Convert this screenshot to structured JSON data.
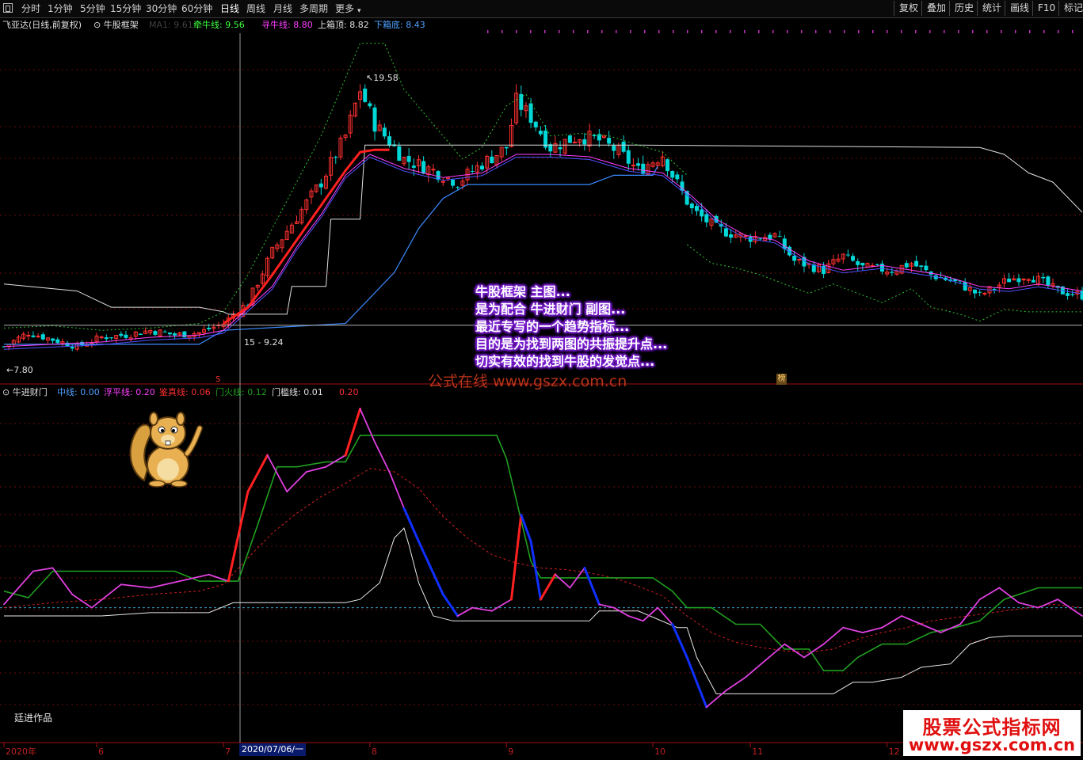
{
  "toolbar": {
    "periods": [
      "分时",
      "1分钟",
      "5分钟",
      "15分钟",
      "30分钟",
      "60分钟",
      "日线",
      "周线",
      "月线",
      "多周期",
      "更多"
    ],
    "active_period": "日线",
    "right_buttons": [
      "复权",
      "叠加",
      "历史",
      "统计",
      "画线",
      "F10",
      "标记"
    ]
  },
  "main_legend": {
    "stock": "飞亚达(日线,前复权)",
    "indicator": "牛股框架",
    "ma_text": "MA1: 9.61",
    "qianniu": "牵牛线: 9.56",
    "xunniu": "寻牛线: 8.80",
    "shangxiang": "上箱顶: 8.82",
    "xiaxiang": "下箱底: 8.43"
  },
  "sub_legend": {
    "indicator": "牛进财门",
    "zhongxian": "中线: 0.00",
    "fupingxian": "浮平线: 0.20",
    "jianzhenxian": "鉴真线: 0.06",
    "menhuoxian": "门火线: 0.12",
    "menkanxian": "门槛线: 0.01",
    "extra": "0.20"
  },
  "annotation": [
    "牛股框架 主图...",
    "是为配合 牛进财门 副图...",
    "最近专写的一个趋势指标...",
    "目的是为找到两图的共振提升点...",
    "切实有效的找到牛股的发觉点..."
  ],
  "watermark_text": "公式在线 www.gszx.com.cn",
  "watermark_box": {
    "line1": "股票公式指标网",
    "line2": "www.gszx.com.cn"
  },
  "credit": "廷进作品",
  "tags": {
    "bang": "榜",
    "s": "S",
    "current_date": "2020/07/06/一"
  },
  "price_labels": {
    "high": "19.58",
    "low": "7.80",
    "mid": "15 - 9.24"
  },
  "axis_labels": [
    {
      "t": 0,
      "label": "2020年"
    },
    {
      "t": 19,
      "label": "6"
    },
    {
      "t": 45,
      "label": "7"
    },
    {
      "t": 75,
      "label": "8"
    },
    {
      "t": 103,
      "label": "9"
    },
    {
      "t": 133,
      "label": "10"
    },
    {
      "t": 153,
      "label": "11"
    },
    {
      "t": 181,
      "label": "12"
    }
  ],
  "colors": {
    "up": "#ff3030",
    "down": "#00d8d8",
    "qianniu": "#ff2020",
    "xunniu": "#ff40ff",
    "box_top": "#e0e0e0",
    "box_bottom": "#3c8cff",
    "band": "#30c030",
    "ma": "#5050ff"
  },
  "chart_data": [
    {
      "type": "candlestick",
      "title": "牛股框架",
      "x_range": [
        0,
        221
      ],
      "ylim": [
        6.8,
        21.5
      ],
      "close_anchors": [
        [
          0,
          7.9
        ],
        [
          5,
          8.5
        ],
        [
          10,
          8.2
        ],
        [
          15,
          7.9
        ],
        [
          20,
          8.3
        ],
        [
          25,
          8.4
        ],
        [
          30,
          8.6
        ],
        [
          35,
          8.4
        ],
        [
          40,
          8.5
        ],
        [
          45,
          8.9
        ],
        [
          50,
          9.8
        ],
        [
          55,
          12.0
        ],
        [
          60,
          13.5
        ],
        [
          65,
          15.0
        ],
        [
          70,
          17.0
        ],
        [
          73,
          19.0
        ],
        [
          76,
          17.5
        ],
        [
          82,
          16.0
        ],
        [
          88,
          15.5
        ],
        [
          93,
          15.0
        ],
        [
          98,
          15.8
        ],
        [
          103,
          16.5
        ],
        [
          105,
          18.5
        ],
        [
          108,
          17.8
        ],
        [
          112,
          16.5
        ],
        [
          118,
          17.0
        ],
        [
          122,
          16.8
        ],
        [
          126,
          16.3
        ],
        [
          130,
          15.5
        ],
        [
          135,
          16.2
        ],
        [
          137,
          15.3
        ],
        [
          141,
          13.8
        ],
        [
          146,
          13.0
        ],
        [
          152,
          12.6
        ],
        [
          158,
          12.7
        ],
        [
          162,
          11.6
        ],
        [
          168,
          11.2
        ],
        [
          172,
          11.8
        ],
        [
          176,
          11.3
        ],
        [
          182,
          11.2
        ],
        [
          186,
          11.5
        ],
        [
          190,
          11.0
        ],
        [
          196,
          10.6
        ],
        [
          200,
          10.1
        ],
        [
          206,
          10.8
        ],
        [
          210,
          11.0
        ],
        [
          216,
          10.3
        ],
        [
          221,
          10.1
        ]
      ],
      "qianniu": [
        [
          45,
          8.9
        ],
        [
          50,
          9.6
        ],
        [
          55,
          11.0
        ],
        [
          60,
          12.5
        ],
        [
          65,
          14.0
        ],
        [
          70,
          15.5
        ],
        [
          73,
          16.3
        ],
        [
          76,
          16.4
        ],
        [
          79,
          16.4
        ]
      ],
      "xunniu": [
        [
          0,
          7.9
        ],
        [
          10,
          8.0
        ],
        [
          20,
          8.1
        ],
        [
          30,
          8.3
        ],
        [
          40,
          8.4
        ],
        [
          45,
          8.6
        ],
        [
          55,
          10.5
        ],
        [
          60,
          12.2
        ],
        [
          65,
          13.6
        ],
        [
          70,
          15.3
        ],
        [
          75,
          16.2
        ],
        [
          82,
          15.6
        ],
        [
          90,
          15.2
        ],
        [
          98,
          15.4
        ],
        [
          105,
          16.2
        ],
        [
          112,
          16.2
        ],
        [
          120,
          16.1
        ],
        [
          128,
          15.6
        ],
        [
          135,
          15.4
        ],
        [
          141,
          14.4
        ],
        [
          146,
          13.4
        ],
        [
          152,
          12.7
        ],
        [
          158,
          12.5
        ],
        [
          165,
          11.6
        ],
        [
          172,
          11.2
        ],
        [
          180,
          11.4
        ],
        [
          186,
          11.2
        ],
        [
          192,
          11.0
        ],
        [
          200,
          10.5
        ],
        [
          206,
          10.4
        ],
        [
          212,
          10.6
        ],
        [
          221,
          10.3
        ]
      ],
      "box_top": [
        [
          0,
          10.6
        ],
        [
          15,
          10.3
        ],
        [
          22,
          9.6
        ],
        [
          40,
          9.6
        ],
        [
          45,
          9.4
        ],
        [
          46,
          9.3
        ],
        [
          58,
          9.3
        ],
        [
          59,
          10.5
        ],
        [
          66,
          10.5
        ],
        [
          67,
          13.4
        ],
        [
          73,
          13.4
        ],
        [
          74,
          16.6
        ],
        [
          130,
          16.6
        ],
        [
          200,
          16.5
        ],
        [
          205,
          16.2
        ],
        [
          210,
          15.4
        ],
        [
          215,
          15.0
        ],
        [
          221,
          13.7
        ]
      ],
      "box_bottom": [
        [
          0,
          8.0
        ],
        [
          40,
          8.0
        ],
        [
          45,
          8.6
        ],
        [
          70,
          8.9
        ],
        [
          80,
          11.1
        ],
        [
          85,
          13.0
        ],
        [
          90,
          14.3
        ],
        [
          95,
          14.9
        ],
        [
          100,
          14.9
        ],
        [
          120,
          14.9
        ],
        [
          125,
          15.3
        ],
        [
          133,
          15.3
        ],
        [
          134,
          15.7
        ]
      ],
      "band_upper": [
        [
          0,
          8.7
        ],
        [
          10,
          8.8
        ],
        [
          20,
          8.6
        ],
        [
          30,
          8.7
        ],
        [
          40,
          8.9
        ],
        [
          45,
          9.4
        ],
        [
          50,
          11.0
        ],
        [
          55,
          13.0
        ],
        [
          60,
          15.0
        ],
        [
          65,
          17.0
        ],
        [
          70,
          19.5
        ],
        [
          73,
          21.0
        ],
        [
          78,
          21.0
        ],
        [
          82,
          19.0
        ],
        [
          88,
          17.5
        ],
        [
          94,
          16.0
        ],
        [
          98,
          16.5
        ],
        [
          103,
          18.3
        ],
        [
          107,
          18.8
        ],
        [
          112,
          17.0
        ],
        [
          118,
          17.1
        ],
        [
          124,
          17.0
        ],
        [
          130,
          16.6
        ],
        [
          135,
          16.3
        ],
        [
          140,
          15.3
        ]
      ],
      "band_lower": [
        [
          140,
          12.3
        ],
        [
          145,
          11.5
        ],
        [
          150,
          11.3
        ],
        [
          155,
          11.0
        ],
        [
          160,
          10.6
        ],
        [
          165,
          10.2
        ],
        [
          170,
          10.6
        ],
        [
          175,
          10.2
        ],
        [
          180,
          9.8
        ],
        [
          186,
          10.4
        ],
        [
          190,
          9.6
        ],
        [
          196,
          9.3
        ],
        [
          200,
          9.0
        ],
        [
          205,
          9.5
        ],
        [
          210,
          9.4
        ],
        [
          216,
          9.4
        ],
        [
          221,
          9.4
        ]
      ],
      "hline": 8.82
    },
    {
      "type": "line",
      "title": "牛进财门",
      "x_range": [
        0,
        221
      ],
      "ylim": [
        -0.8,
        1.25
      ],
      "zhongxian": 0.0,
      "fuping": [
        [
          0,
          0.02
        ],
        [
          6,
          0.22
        ],
        [
          10,
          0.24
        ],
        [
          14,
          0.08
        ],
        [
          18,
          0.0
        ],
        [
          24,
          0.14
        ],
        [
          30,
          0.12
        ],
        [
          36,
          0.16
        ],
        [
          42,
          0.2
        ],
        [
          46,
          0.16
        ],
        [
          50,
          0.7
        ],
        [
          54,
          0.92
        ],
        [
          58,
          0.7
        ],
        [
          62,
          0.82
        ],
        [
          66,
          0.85
        ],
        [
          70,
          0.92
        ],
        [
          73,
          1.2
        ],
        [
          76,
          1.0
        ],
        [
          79,
          0.82
        ],
        [
          82,
          0.6
        ],
        [
          85,
          0.4
        ],
        [
          90,
          0.08
        ],
        [
          93,
          -0.05
        ],
        [
          96,
          0.0
        ],
        [
          100,
          -0.02
        ],
        [
          104,
          0.05
        ],
        [
          106,
          0.56
        ],
        [
          108,
          0.4
        ],
        [
          110,
          0.05
        ],
        [
          113,
          0.2
        ],
        [
          116,
          0.12
        ],
        [
          119,
          0.24
        ],
        [
          122,
          0.02
        ],
        [
          125,
          0.0
        ],
        [
          128,
          -0.05
        ],
        [
          131,
          -0.08
        ],
        [
          134,
          0.0
        ],
        [
          137,
          -0.1
        ],
        [
          140,
          -0.3
        ],
        [
          144,
          -0.6
        ],
        [
          148,
          -0.5
        ],
        [
          152,
          -0.42
        ],
        [
          156,
          -0.32
        ],
        [
          160,
          -0.22
        ],
        [
          164,
          -0.3
        ],
        [
          168,
          -0.22
        ],
        [
          172,
          -0.12
        ],
        [
          176,
          -0.15
        ],
        [
          180,
          -0.12
        ],
        [
          184,
          -0.05
        ],
        [
          188,
          -0.1
        ],
        [
          192,
          -0.15
        ],
        [
          196,
          -0.1
        ],
        [
          200,
          0.05
        ],
        [
          204,
          0.12
        ],
        [
          208,
          0.03
        ],
        [
          212,
          0.0
        ],
        [
          216,
          0.05
        ],
        [
          221,
          -0.05
        ]
      ],
      "jianzhen": [
        [
          0,
          0.0
        ],
        [
          10,
          0.03
        ],
        [
          20,
          0.05
        ],
        [
          30,
          0.08
        ],
        [
          40,
          0.1
        ],
        [
          45,
          0.14
        ],
        [
          50,
          0.3
        ],
        [
          55,
          0.45
        ],
        [
          60,
          0.57
        ],
        [
          65,
          0.67
        ],
        [
          70,
          0.75
        ],
        [
          75,
          0.84
        ],
        [
          80,
          0.82
        ],
        [
          85,
          0.72
        ],
        [
          90,
          0.55
        ],
        [
          95,
          0.42
        ],
        [
          100,
          0.32
        ],
        [
          105,
          0.27
        ],
        [
          110,
          0.24
        ],
        [
          115,
          0.23
        ],
        [
          120,
          0.21
        ],
        [
          125,
          0.18
        ],
        [
          130,
          0.13
        ],
        [
          135,
          0.07
        ],
        [
          140,
          -0.05
        ],
        [
          145,
          -0.15
        ],
        [
          150,
          -0.21
        ],
        [
          155,
          -0.24
        ],
        [
          160,
          -0.26
        ],
        [
          165,
          -0.27
        ],
        [
          170,
          -0.25
        ],
        [
          175,
          -0.19
        ],
        [
          180,
          -0.15
        ],
        [
          185,
          -0.12
        ],
        [
          190,
          -0.08
        ],
        [
          195,
          -0.06
        ],
        [
          200,
          -0.04
        ],
        [
          205,
          -0.02
        ],
        [
          210,
          0.0
        ],
        [
          215,
          0.02
        ],
        [
          221,
          0.0
        ]
      ],
      "menhuo": [
        [
          0,
          0.1
        ],
        [
          5,
          0.06
        ],
        [
          10,
          0.22
        ],
        [
          15,
          0.22
        ],
        [
          35,
          0.22
        ],
        [
          40,
          0.16
        ],
        [
          48,
          0.16
        ],
        [
          52,
          0.5
        ],
        [
          56,
          0.85
        ],
        [
          60,
          0.85
        ],
        [
          66,
          0.88
        ],
        [
          70,
          0.88
        ],
        [
          73,
          1.04
        ],
        [
          75,
          1.04
        ],
        [
          101,
          1.04
        ],
        [
          103,
          0.9
        ],
        [
          108,
          0.28
        ],
        [
          110,
          0.18
        ],
        [
          133,
          0.18
        ],
        [
          137,
          0.1
        ],
        [
          140,
          0.0
        ],
        [
          145,
          0.0
        ],
        [
          150,
          -0.1
        ],
        [
          155,
          -0.1
        ],
        [
          160,
          -0.25
        ],
        [
          165,
          -0.25
        ],
        [
          168,
          -0.38
        ],
        [
          172,
          -0.38
        ],
        [
          175,
          -0.3
        ],
        [
          180,
          -0.22
        ],
        [
          185,
          -0.22
        ],
        [
          190,
          -0.15
        ],
        [
          195,
          -0.12
        ],
        [
          200,
          -0.08
        ],
        [
          205,
          0.05
        ],
        [
          212,
          0.12
        ],
        [
          221,
          0.12
        ]
      ],
      "menkan": [
        [
          0,
          -0.05
        ],
        [
          20,
          -0.05
        ],
        [
          30,
          -0.03
        ],
        [
          42,
          -0.03
        ],
        [
          47,
          0.03
        ],
        [
          70,
          0.03
        ],
        [
          73,
          0.05
        ],
        [
          77,
          0.15
        ],
        [
          80,
          0.42
        ],
        [
          82,
          0.48
        ],
        [
          83,
          0.38
        ],
        [
          85,
          0.15
        ],
        [
          88,
          -0.05
        ],
        [
          92,
          -0.08
        ],
        [
          100,
          -0.08
        ],
        [
          115,
          -0.08
        ],
        [
          120,
          -0.08
        ],
        [
          122,
          -0.02
        ],
        [
          130,
          -0.02
        ],
        [
          138,
          -0.12
        ],
        [
          140,
          -0.12
        ],
        [
          142,
          -0.3
        ],
        [
          146,
          -0.52
        ],
        [
          150,
          -0.52
        ],
        [
          160,
          -0.52
        ],
        [
          166,
          -0.52
        ],
        [
          170,
          -0.52
        ],
        [
          174,
          -0.45
        ],
        [
          178,
          -0.45
        ],
        [
          184,
          -0.42
        ],
        [
          188,
          -0.36
        ],
        [
          194,
          -0.34
        ],
        [
          198,
          -0.22
        ],
        [
          202,
          -0.18
        ],
        [
          206,
          -0.17
        ],
        [
          210,
          -0.17
        ],
        [
          221,
          -0.17
        ]
      ]
    }
  ]
}
